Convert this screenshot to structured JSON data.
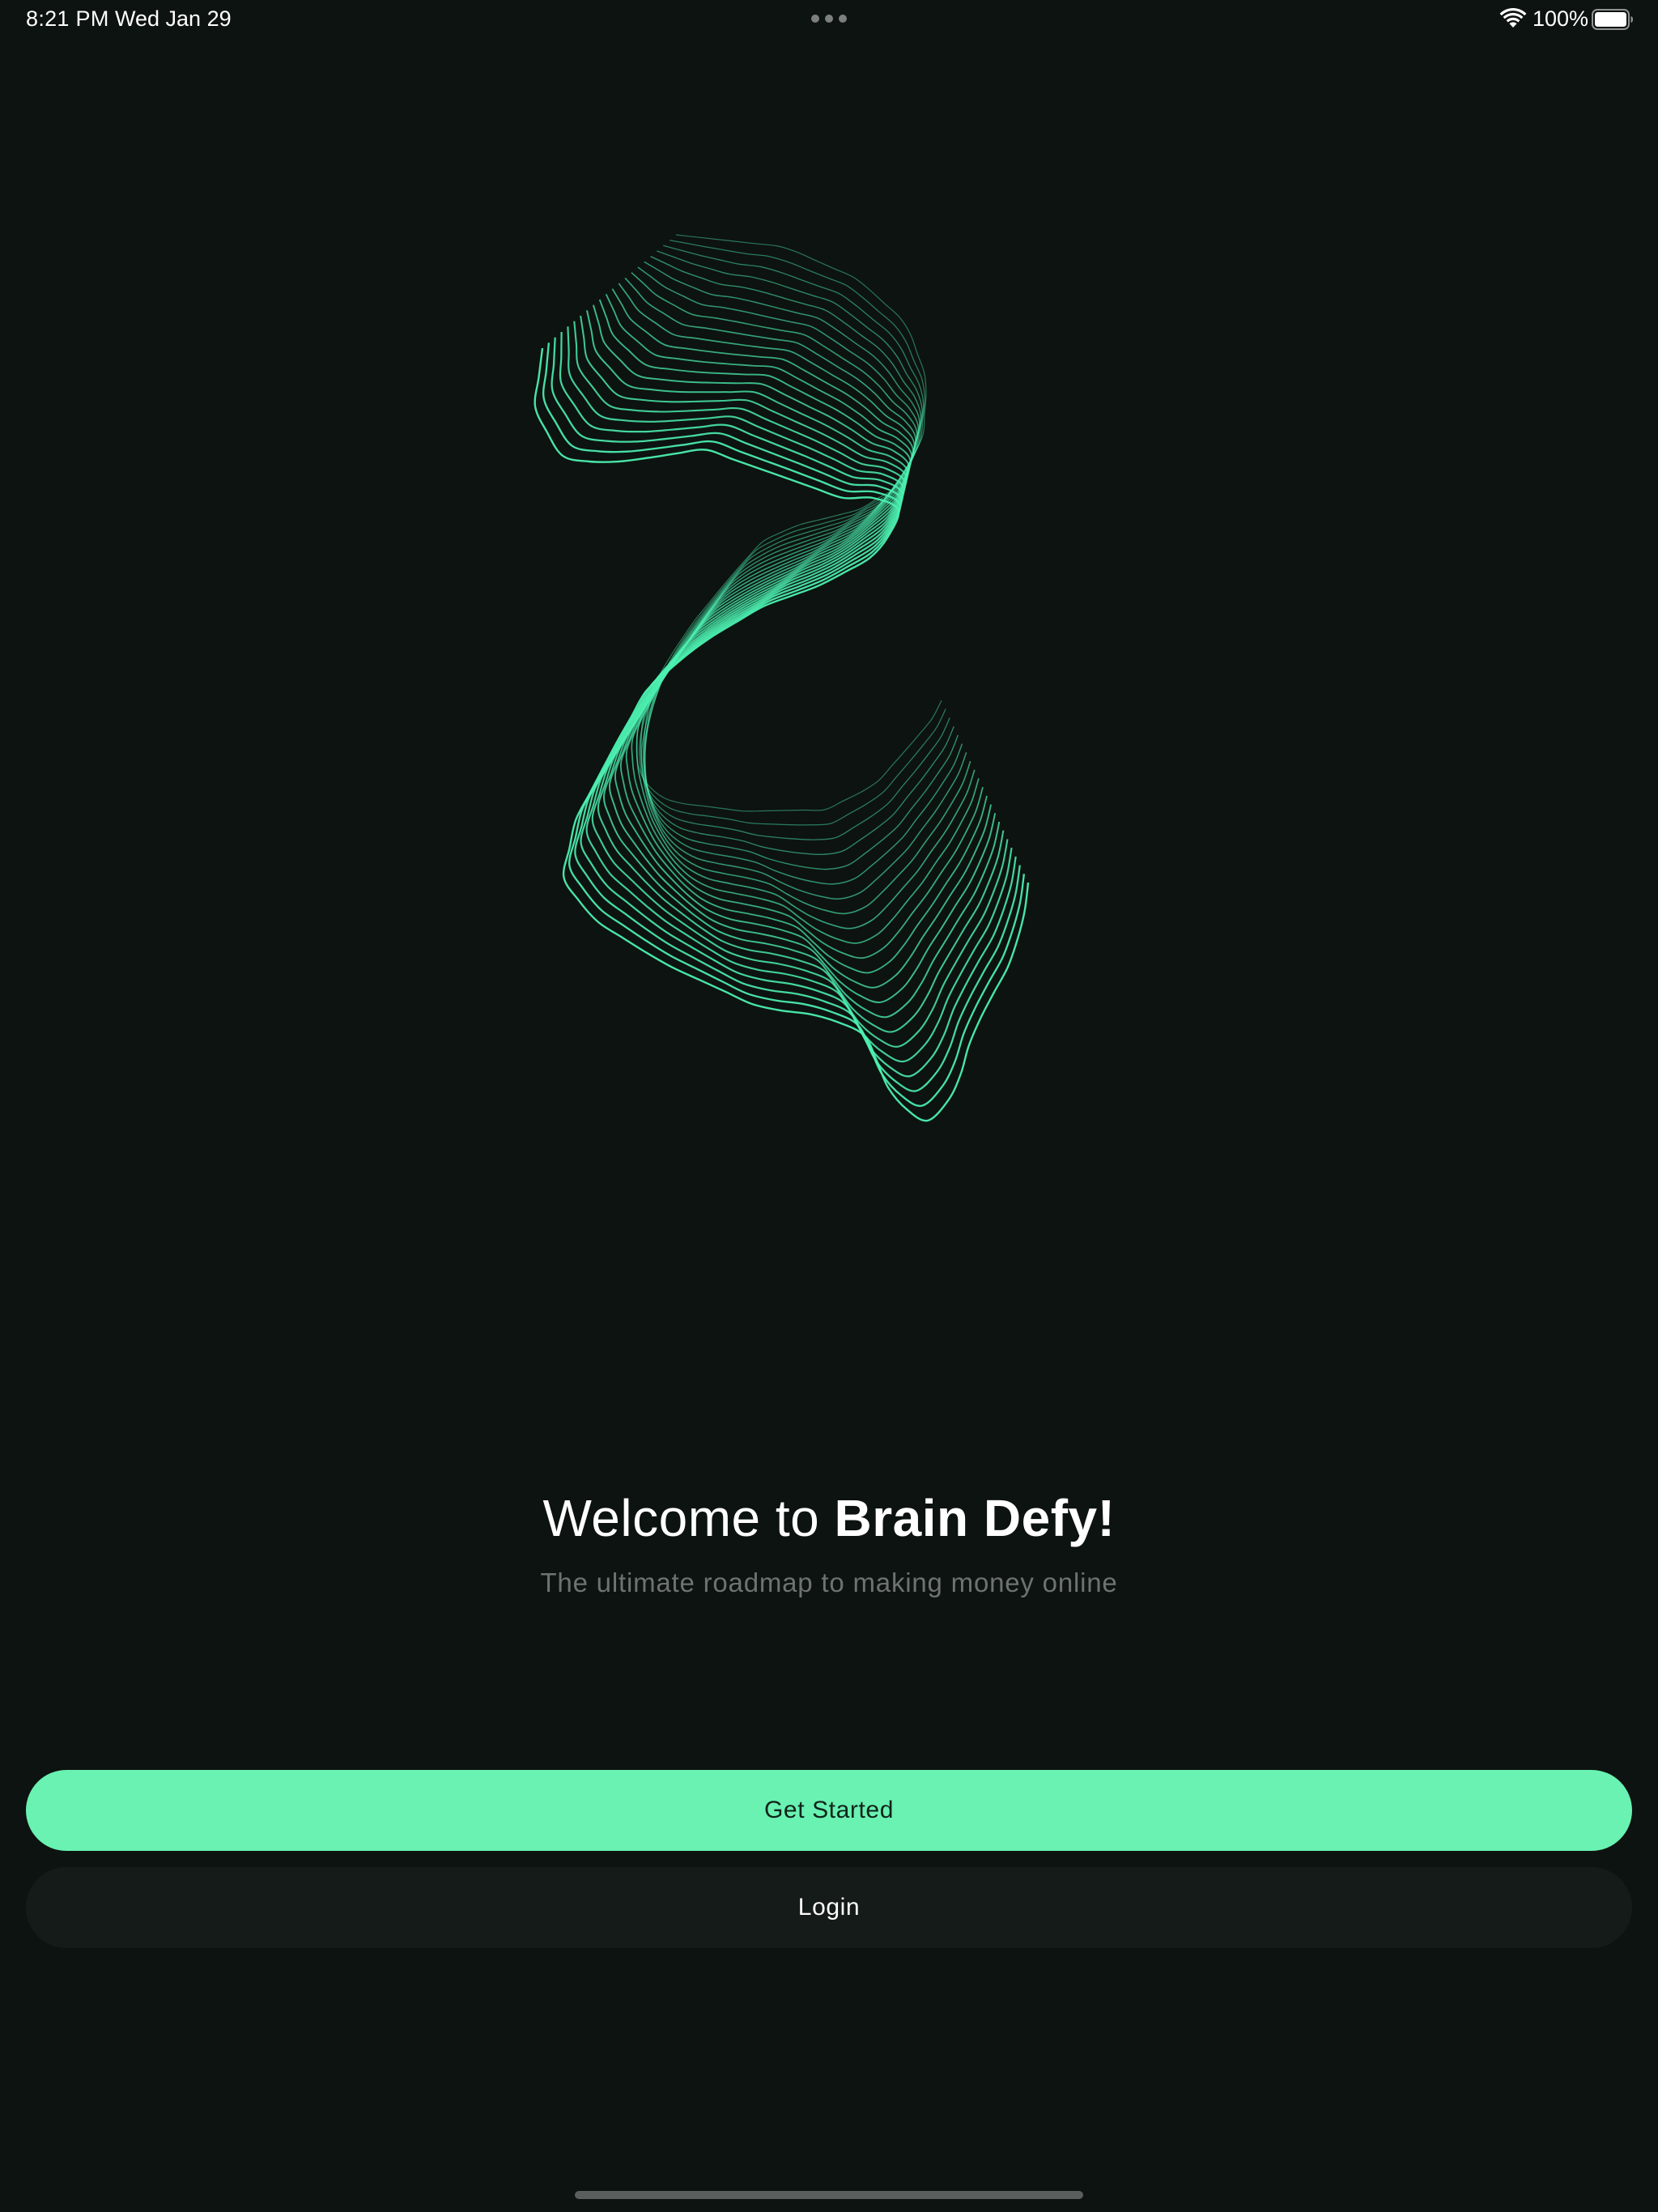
{
  "status_bar": {
    "time": "8:21 PM",
    "date": "Wed Jan 29",
    "battery_percent": "100%",
    "battery_level": 1.0,
    "icons": [
      "wifi-icon",
      "battery-icon",
      "multitask-dots-icon"
    ]
  },
  "hero": {
    "illustration": "flowing-line-wave-icon",
    "accent_color": "#4cf0b0"
  },
  "welcome": {
    "title_prefix": "Welcome to ",
    "brand_name": "Brain Defy!",
    "subtitle": "The ultimate roadmap to making money online"
  },
  "actions": {
    "primary_label": "Get Started",
    "secondary_label": "Login"
  },
  "colors": {
    "background": "#0d1311",
    "primary_button": "#69f2b1",
    "secondary_button": "#151b19",
    "subtitle_text": "#6e7370"
  }
}
